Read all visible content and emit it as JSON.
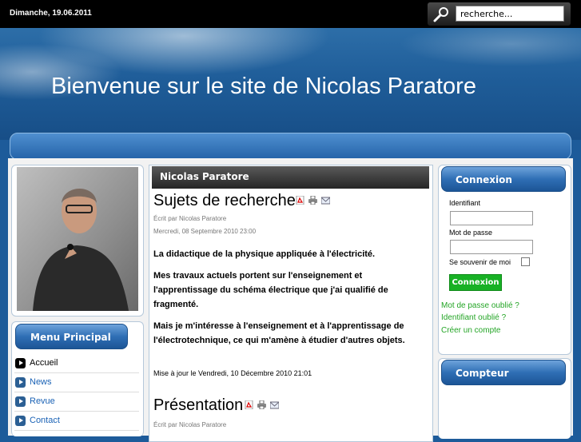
{
  "topbar": {
    "date": "Dimanche, 19.06.2011",
    "search_placeholder": "recherche..."
  },
  "banner": {
    "title": "Bienvenue sur le site de Nicolas Paratore"
  },
  "menu": {
    "title": "Menu Principal",
    "items": [
      {
        "label": "Accueil"
      },
      {
        "label": "News"
      },
      {
        "label": "Revue"
      },
      {
        "label": "Contact"
      }
    ]
  },
  "main": {
    "header": "Nicolas Paratore",
    "articles": [
      {
        "title": "Sujets de recherche",
        "author": "Écrit par Nicolas Paratore",
        "date": "Mercredi, 08 Septembre 2010 23:00",
        "paragraphs": [
          "La didactique de la physique appliquée à l'électricité.",
          "Mes travaux actuels portent sur l'enseignement et l'apprentissage du schéma électrique que j'ai qualifié de fragmenté.",
          "Mais je m'intéresse à l'enseignement et à l'apprentissage de l'électrotechnique, ce qui m'amène à étudier d'autres objets."
        ],
        "updated": "Mise à jour le Vendredi, 10 Décembre 2010 21:01"
      },
      {
        "title": "Présentation",
        "author": "Écrit par Nicolas Paratore"
      }
    ],
    "icons": [
      "pdf-icon",
      "print-icon",
      "email-icon"
    ]
  },
  "login": {
    "title": "Connexion",
    "username_label": "Identifiant",
    "password_label": "Mot de passe",
    "remember_label": "Se souvenir de moi",
    "button": "Connexion",
    "links": [
      "Mot de passe oublié ?",
      "Identifiant oublié ?",
      "Créer un compte"
    ]
  },
  "counter": {
    "title": "Compteur"
  },
  "colors": {
    "accent_blue": "#2f6fb5",
    "link_green": "#24a526",
    "button_green": "#18b125"
  }
}
